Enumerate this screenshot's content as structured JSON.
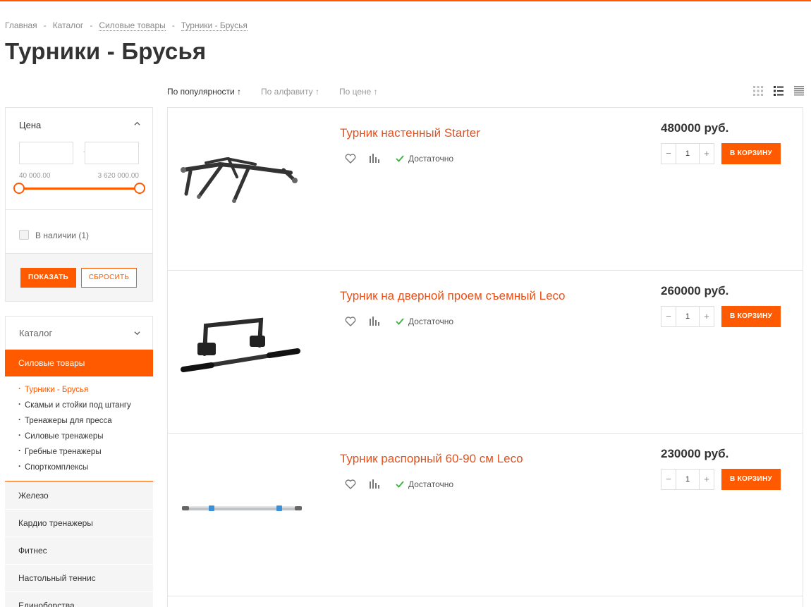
{
  "colors": {
    "accent": "#ff5a00",
    "title_link": "#e8501a",
    "stock_ok": "#3cb13c"
  },
  "breadcrumb": [
    "Главная",
    "Каталог",
    "Силовые товары",
    "Турники - Брусья"
  ],
  "page_title": "Турники - Брусья",
  "sort": [
    {
      "label": "По популярности ↑",
      "active": true
    },
    {
      "label": "По алфавиту ↑",
      "active": false
    },
    {
      "label": "По цене ↑",
      "active": false
    }
  ],
  "views": [
    "grid-view-icon",
    "list-view-icon",
    "table-view-icon"
  ],
  "filter": {
    "title": "Цена",
    "price_from_placeholder": "",
    "price_to_placeholder": "",
    "min_label": "40 000.00",
    "max_label": "3 620 000.00",
    "availability_label": "В наличии (1)",
    "show_button": "ПОКАЗАТЬ",
    "reset_button": "СБРОСИТЬ"
  },
  "catalog": {
    "title": "Каталог",
    "active_section": "Силовые товары",
    "subitems": [
      "Турники - Брусья",
      "Скамьи и стойки под штангу",
      "Тренажеры для пресса",
      "Силовые тренажеры",
      "Гребные тренажеры",
      "Спорткомплексы"
    ],
    "current_subitem": 0,
    "sections": [
      "Железо",
      "Кардио тренажеры",
      "Фитнес",
      "Настольный теннис",
      "Единоборства"
    ]
  },
  "products": [
    {
      "name": "Турник настенный Starter",
      "price": "480000 руб.",
      "stock": "Достаточно",
      "qty": "1",
      "cart_button": "В КОРЗИНУ"
    },
    {
      "name": "Турник на дверной проем съемный Leco",
      "price": "260000 руб.",
      "stock": "Достаточно",
      "qty": "1",
      "cart_button": "В КОРЗИНУ"
    },
    {
      "name": "Турник распорный 60-90 см Leco",
      "price": "230000 руб.",
      "stock": "Достаточно",
      "qty": "1",
      "cart_button": "В КОРЗИНУ"
    }
  ]
}
